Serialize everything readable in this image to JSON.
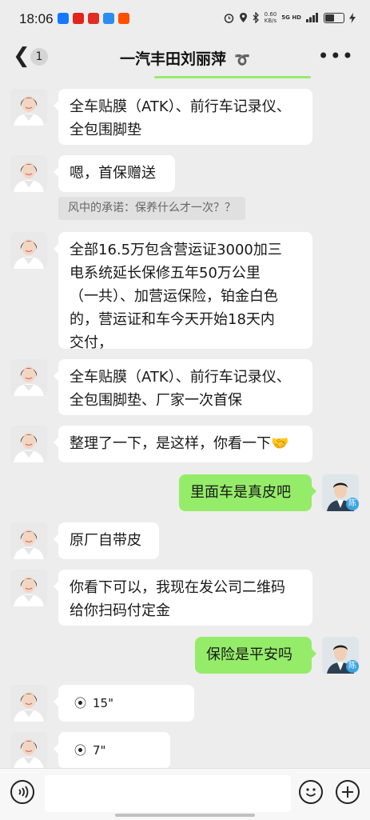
{
  "status": {
    "time": "18:06",
    "net_speed": "0.60",
    "net_unit": "KB/s",
    "network": "5G HD",
    "app_icons": [
      {
        "name": "alipay-icon",
        "color": "#1677ff"
      },
      {
        "name": "jd-icon",
        "color": "#e1251b"
      },
      {
        "name": "pinduoduo-icon",
        "color": "#e02e24"
      },
      {
        "name": "cloud-icon",
        "color": "#2d8cf0"
      },
      {
        "name": "taobao-icon",
        "color": "#ff5000"
      }
    ]
  },
  "nav": {
    "back_icon": "chevron-left-icon",
    "unread": "1",
    "title": "一汽丰田刘丽萍",
    "ear_icon": "ear-icon",
    "more_icon": "more-dots-icon"
  },
  "messages": [
    {
      "text_1": "全车贴膜（ATK）、前行车记录仪、",
      "text_2": "全包围脚垫"
    },
    {
      "text_1": "嗯，首保赠送"
    },
    {
      "quote": "风中的承诺：保养什么才一次？？"
    },
    {
      "text_1": "全部16.5万包含营运证3000加三",
      "text_2": "电系统延长保修五年50万公里",
      "text_3": "（一共）、加营运保险，铂金白色",
      "text_4": "的，营运证和车今天开始18天内",
      "text_5": "交付，"
    },
    {
      "text_1": "全车贴膜（ATK）、前行车记录仪、",
      "text_2": "全包围脚垫、厂家一次首保"
    },
    {
      "text_1": "整理了一下，是这样，你看一下",
      "emoji": "🤝"
    },
    {
      "text_1": "里面车是真皮吧"
    },
    {
      "text_1": "原厂自带皮"
    },
    {
      "text_1": "你看下可以，我现在发公司二维码",
      "text_2": "给你扫码付定金"
    },
    {
      "text_1": "保险是平安吗"
    },
    {
      "voice": "15\""
    },
    {
      "voice": "7\""
    }
  ],
  "self_avatar_badge": "陈",
  "input": {
    "voice_icon": "voice-toggle-icon",
    "emoji_icon": "emoji-icon",
    "plus_icon": "plus-icon",
    "placeholder": ""
  },
  "colors": {
    "bubble_out": "#95ec69",
    "bubble_in": "#ffffff",
    "background": "#ededed"
  }
}
